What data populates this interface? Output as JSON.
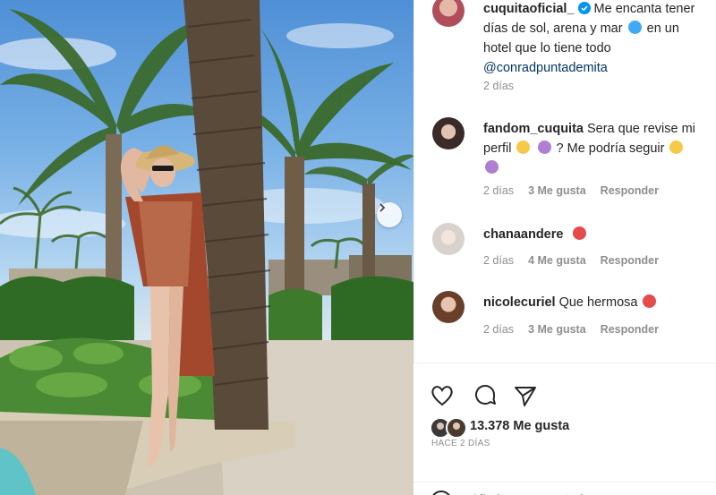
{
  "post": {
    "username": "cuquitaoficial_",
    "caption_part1": "Me encanta tener días de sol, arena y mar",
    "caption_part2": "en un hotel que lo tiene todo",
    "mention": "@conradpuntademita",
    "time": "2 días"
  },
  "comments": [
    {
      "user": "fandom_cuquita",
      "text1": "Sera que revise mi perfil",
      "text2": "? Me podría seguir",
      "time": "2 días",
      "likes": "3 Me gusta",
      "reply": "Responder"
    },
    {
      "user": "chanaandere",
      "text1": "",
      "text2": "",
      "time": "2 días",
      "likes": "4 Me gusta",
      "reply": "Responder"
    },
    {
      "user": "nicolecuriel",
      "text1": "Que hermosa",
      "text2": "",
      "time": "2 días",
      "likes": "3 Me gusta",
      "reply": "Responder"
    }
  ],
  "likes": {
    "count": "13.378",
    "label": "Me gusta"
  },
  "posted_ago": "HACE 2 DÍAS",
  "add_comment": {
    "placeholder": "Añade un comentario..."
  },
  "icons": {
    "verified": "verified-badge-icon",
    "like": "heart-icon",
    "comment": "comment-bubble-icon",
    "share": "paper-plane-icon",
    "next": "chevron-right-icon",
    "emoji_smile": "emoji-icon"
  },
  "colors": {
    "link": "#00376b",
    "verified": "#0095f6",
    "muted": "#8e8e8e",
    "text": "#262626"
  }
}
